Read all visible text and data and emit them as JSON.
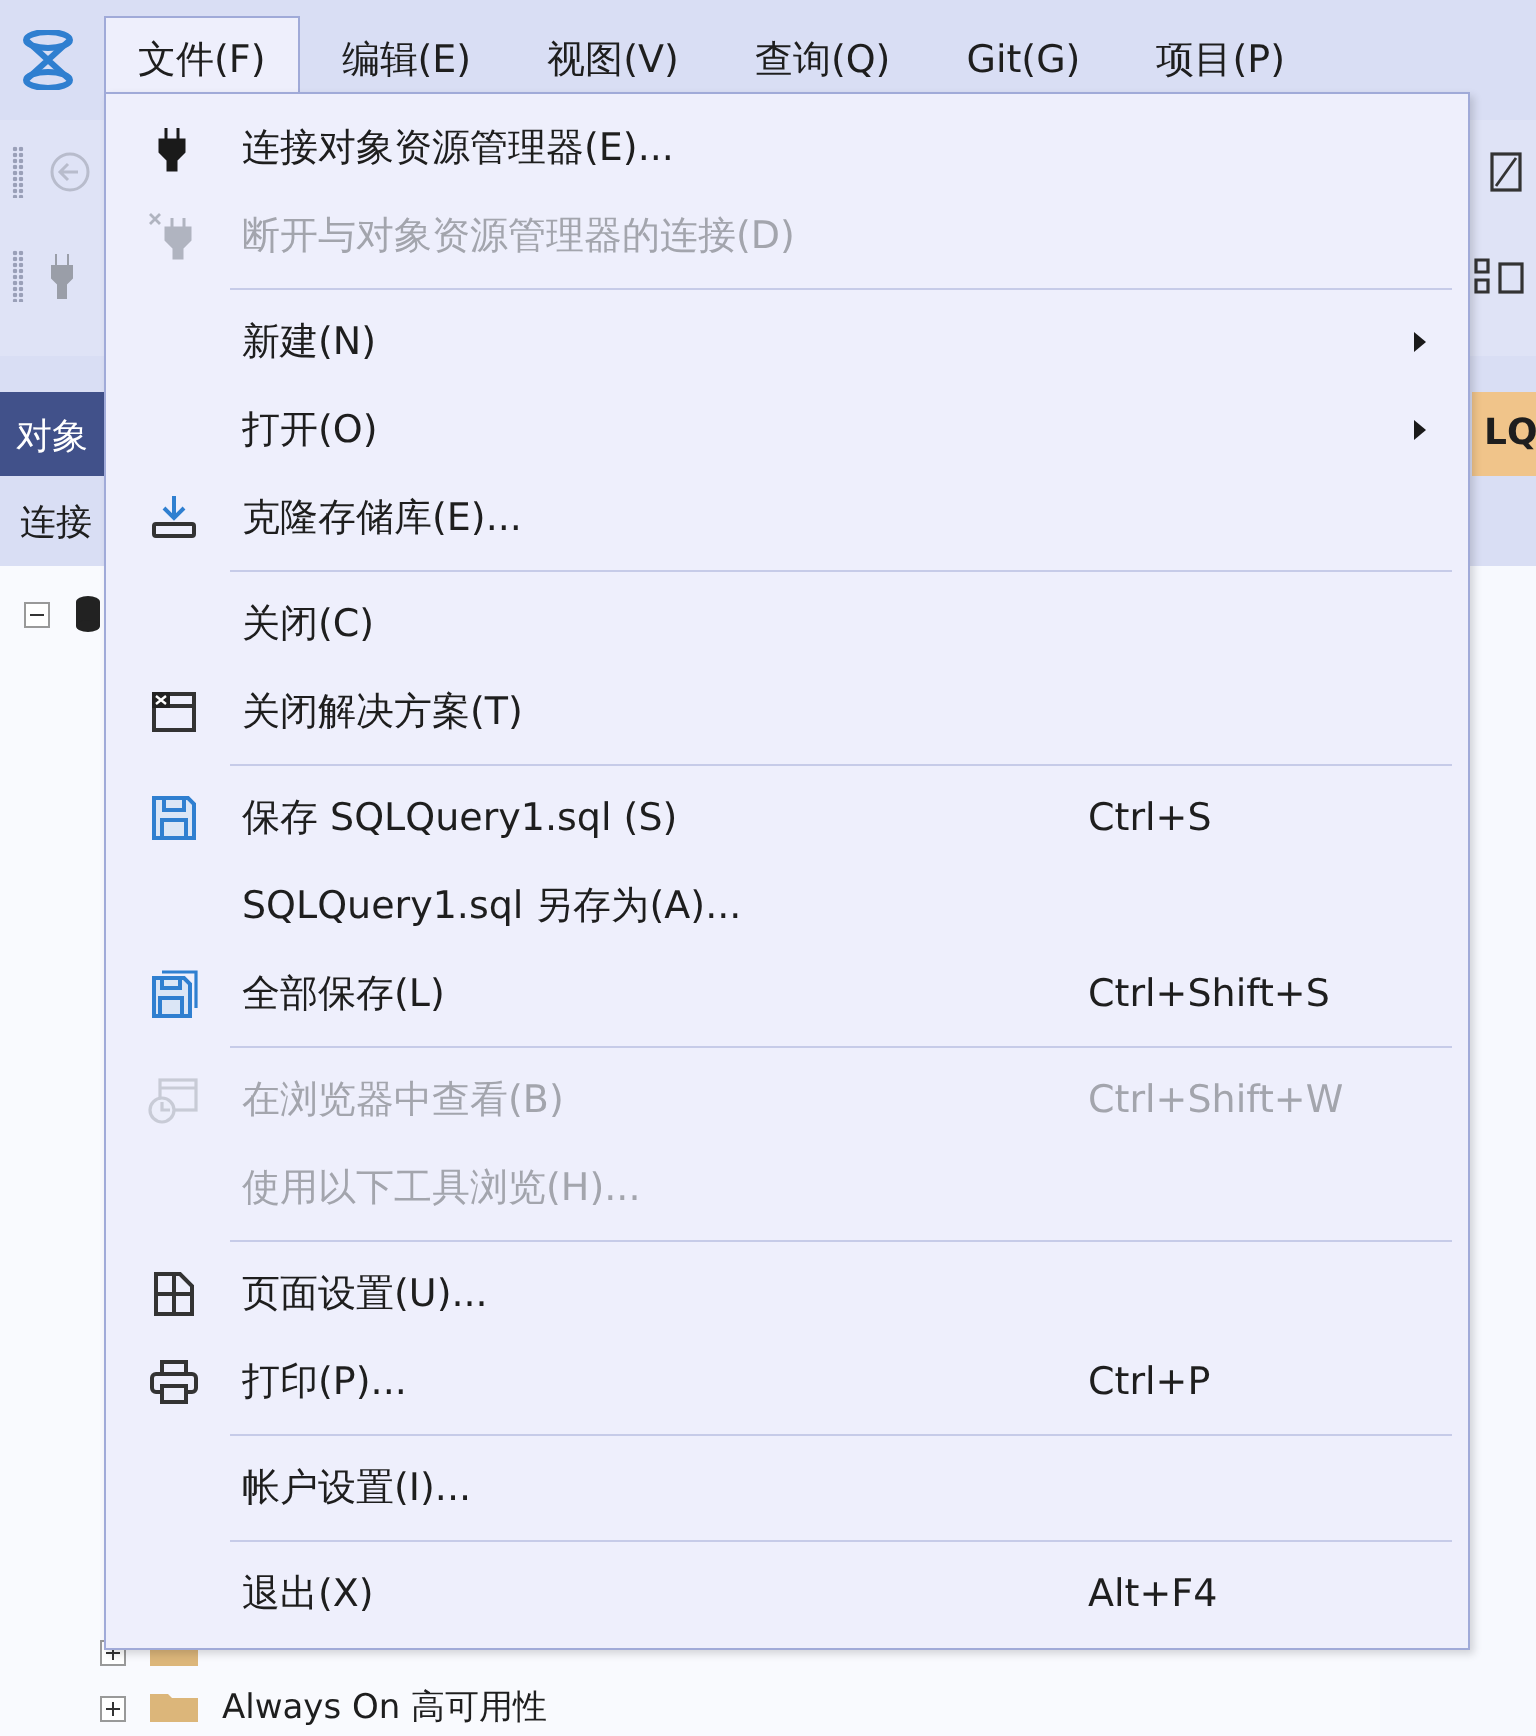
{
  "menubar": {
    "items": [
      {
        "label": "文件(F)",
        "selected": true
      },
      {
        "label": "编辑(E)",
        "selected": false
      },
      {
        "label": "视图(V)",
        "selected": false
      },
      {
        "label": "查询(Q)",
        "selected": false
      },
      {
        "label": "Git(G)",
        "selected": false
      },
      {
        "label": "项目(P)",
        "selected": false
      }
    ]
  },
  "panel": {
    "tab": "对象",
    "toolbar_label": "连接",
    "tree": [
      {
        "label": "Always On 高可用性"
      }
    ]
  },
  "editor": {
    "tab": "LQ"
  },
  "file_menu": {
    "items": [
      {
        "kind": "item",
        "label": "连接对象资源管理器(E)...",
        "disabled": false,
        "submenu": false
      },
      {
        "kind": "item",
        "label": "断开与对象资源管理器的连接(D)",
        "disabled": true,
        "submenu": false
      },
      {
        "kind": "separator"
      },
      {
        "kind": "item",
        "label": "新建(N)",
        "disabled": false,
        "submenu": true
      },
      {
        "kind": "item",
        "label": "打开(O)",
        "disabled": false,
        "submenu": true
      },
      {
        "kind": "item",
        "label": "克隆存储库(E)...",
        "disabled": false,
        "submenu": false
      },
      {
        "kind": "separator"
      },
      {
        "kind": "item",
        "label": "关闭(C)",
        "disabled": false,
        "submenu": false
      },
      {
        "kind": "item",
        "label": "关闭解决方案(T)",
        "disabled": false,
        "submenu": false
      },
      {
        "kind": "separator"
      },
      {
        "kind": "item",
        "label": "保存 SQLQuery1.sql (S)",
        "shortcut": "Ctrl+S",
        "disabled": false,
        "submenu": false
      },
      {
        "kind": "item",
        "label": "SQLQuery1.sql 另存为(A)...",
        "disabled": false,
        "submenu": false
      },
      {
        "kind": "item",
        "label": "全部保存(L)",
        "shortcut": "Ctrl+Shift+S",
        "disabled": false,
        "submenu": false
      },
      {
        "kind": "separator"
      },
      {
        "kind": "item",
        "label": "在浏览器中查看(B)",
        "shortcut": "Ctrl+Shift+W",
        "disabled": true,
        "submenu": false
      },
      {
        "kind": "item",
        "label": "使用以下工具浏览(H)...",
        "disabled": true,
        "submenu": false
      },
      {
        "kind": "separator"
      },
      {
        "kind": "item",
        "label": "页面设置(U)...",
        "disabled": false,
        "submenu": false
      },
      {
        "kind": "item",
        "label": "打印(P)...",
        "shortcut": "Ctrl+P",
        "disabled": false,
        "submenu": false
      },
      {
        "kind": "separator"
      },
      {
        "kind": "item",
        "label": "帐户设置(I)...",
        "disabled": false,
        "submenu": false
      },
      {
        "kind": "separator"
      },
      {
        "kind": "item",
        "label": "退出(X)",
        "shortcut": "Alt+F4",
        "disabled": false,
        "submenu": false
      }
    ]
  }
}
